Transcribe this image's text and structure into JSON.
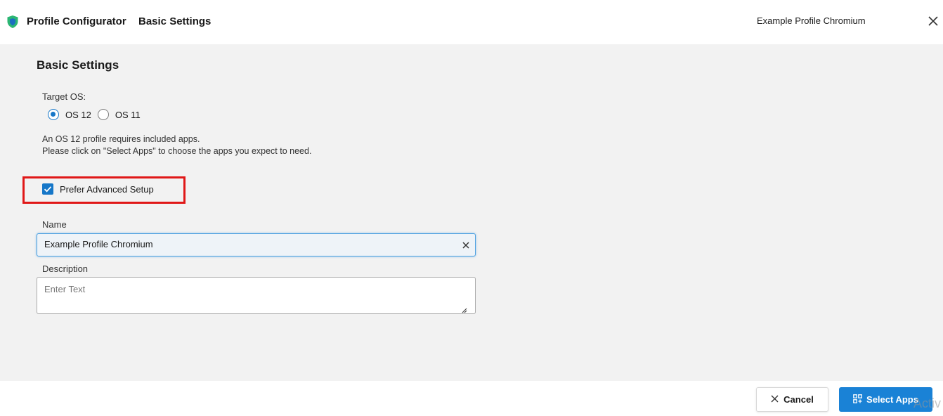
{
  "header": {
    "app_title": "Profile Configurator",
    "section_title": "Basic Settings",
    "profile_name": "Example Profile Chromium"
  },
  "main": {
    "heading": "Basic Settings",
    "target_os": {
      "label": "Target OS:",
      "options": [
        {
          "label": "OS 12",
          "selected": true
        },
        {
          "label": "OS 11",
          "selected": false
        }
      ]
    },
    "info_lines": [
      "An OS 12 profile requires included apps.",
      "Please click on \"Select Apps\" to choose the apps you expect to need."
    ],
    "advanced_setup": {
      "label": "Prefer Advanced Setup",
      "checked": true
    },
    "name": {
      "label": "Name",
      "value": "Example Profile Chromium"
    },
    "description": {
      "label": "Description",
      "placeholder": "Enter Text"
    }
  },
  "footer": {
    "cancel_label": "Cancel",
    "select_apps_label": "Select Apps",
    "watermark": "Activ"
  },
  "colors": {
    "accent": "#1a82d6",
    "highlight": "#e01818",
    "logo_green": "#2bb673"
  }
}
